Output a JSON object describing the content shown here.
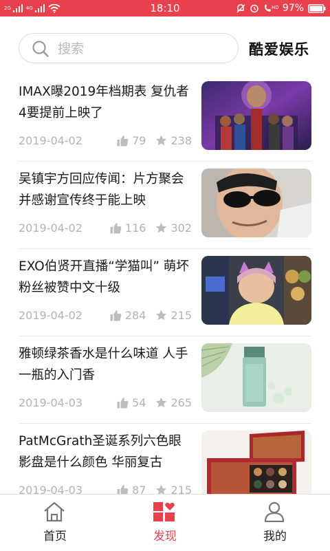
{
  "status_bar": {
    "network_label_1": "2G",
    "network_label_2": "4G",
    "time": "18:10",
    "battery_percent": "97%",
    "icons": [
      "signal-icon",
      "wifi-icon",
      "notification-icon",
      "alarm-icon",
      "hd-call-icon",
      "battery-icon"
    ]
  },
  "header": {
    "search_placeholder": "搜索",
    "brand": "酷爱娱乐"
  },
  "articles": [
    {
      "title": "IMAX曝2019年档期表 复仇者4要提前上映了",
      "date": "2019-04-02",
      "likes": "79",
      "stars": "238"
    },
    {
      "title": "吴镇宇方回应传闻：片方聚会并感谢宣传终于能上映",
      "date": "2019-04-02",
      "likes": "116",
      "stars": "302"
    },
    {
      "title": "EXO伯贤开直播“学猫叫” 萌坏粉丝被赞中文十级",
      "date": "2019-04-02",
      "likes": "284",
      "stars": "215"
    },
    {
      "title": "雅顿绿茶香水是什么味道 人手一瓶的入门香",
      "date": "2019-04-03",
      "likes": "54",
      "stars": "265"
    },
    {
      "title": "PatMcGrath圣诞系列六色眼影盘是什么颜色 华丽复古",
      "date": "2019-04-03",
      "likes": "87",
      "stars": "215"
    }
  ],
  "tab_bar": {
    "tabs": [
      {
        "label": "首页",
        "icon": "home-icon",
        "active": false
      },
      {
        "label": "发现",
        "icon": "discover-icon",
        "active": true
      },
      {
        "label": "我的",
        "icon": "profile-icon",
        "active": false
      }
    ]
  },
  "colors": {
    "accent": "#e8414d",
    "meta_text": "#b3b3b3",
    "title_text": "#1a1a1a"
  }
}
